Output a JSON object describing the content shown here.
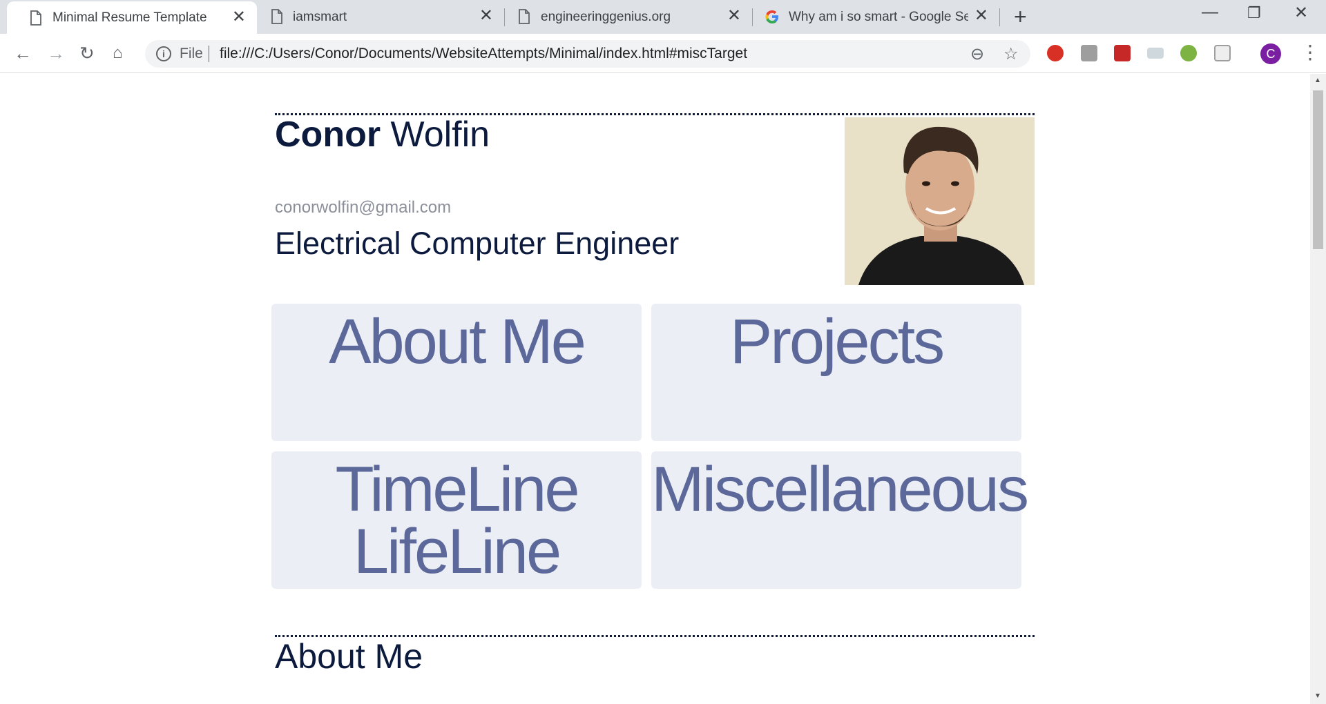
{
  "browser": {
    "tabs": [
      {
        "title": "Minimal Resume Template",
        "icon": "page-icon",
        "active": true
      },
      {
        "title": "iamsmart",
        "icon": "page-icon",
        "active": false
      },
      {
        "title": "engineeringgenius.org",
        "icon": "page-icon",
        "active": false
      },
      {
        "title": "Why am i so smart - Google Sear",
        "icon": "google-icon",
        "active": false
      }
    ],
    "omnibox": {
      "scheme_label": "File",
      "url": "file:///C:/Users/Conor/Documents/WebsiteAttempts/Minimal/index.html#miscTarget"
    },
    "profile_initial": "C"
  },
  "page": {
    "first_name": "Conor",
    "last_name": "Wolfin",
    "email": "conorwolfin@gmail.com",
    "role": "Electrical Computer Engineer",
    "cards": [
      {
        "line1": "About Me",
        "line2": ""
      },
      {
        "line1": "Projects",
        "line2": ""
      },
      {
        "line1": "TimeLine",
        "line2": "LifeLine"
      },
      {
        "line1": "Miscellaneous",
        "line2": ""
      }
    ],
    "section_title": "About Me"
  },
  "colors": {
    "accent_text": "#0b1a3d",
    "card_bg": "#ebeef5",
    "card_text": "#5b6899"
  }
}
